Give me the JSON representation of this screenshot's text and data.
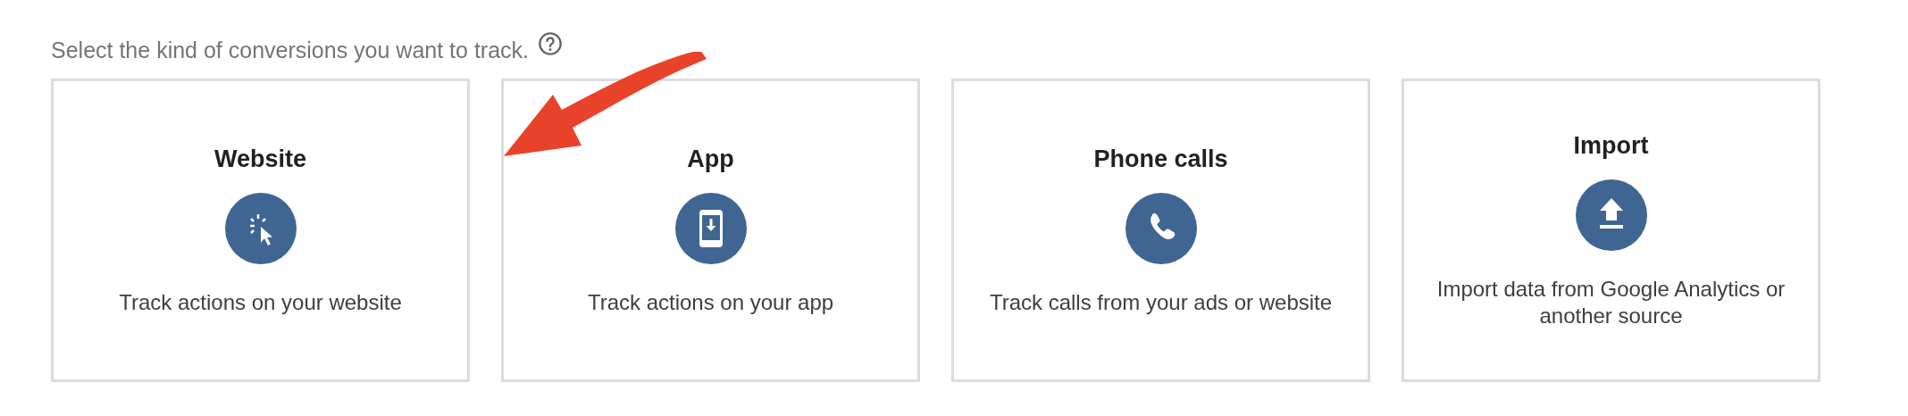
{
  "prompt": "Select the kind of conversions you want to track.",
  "cards": [
    {
      "title": "Website",
      "description": "Track actions on your website"
    },
    {
      "title": "App",
      "description": "Track actions on your app"
    },
    {
      "title": "Phone calls",
      "description": "Track calls from your ads or website"
    },
    {
      "title": "Import",
      "description": "Import data from Google Analytics or another source"
    }
  ]
}
